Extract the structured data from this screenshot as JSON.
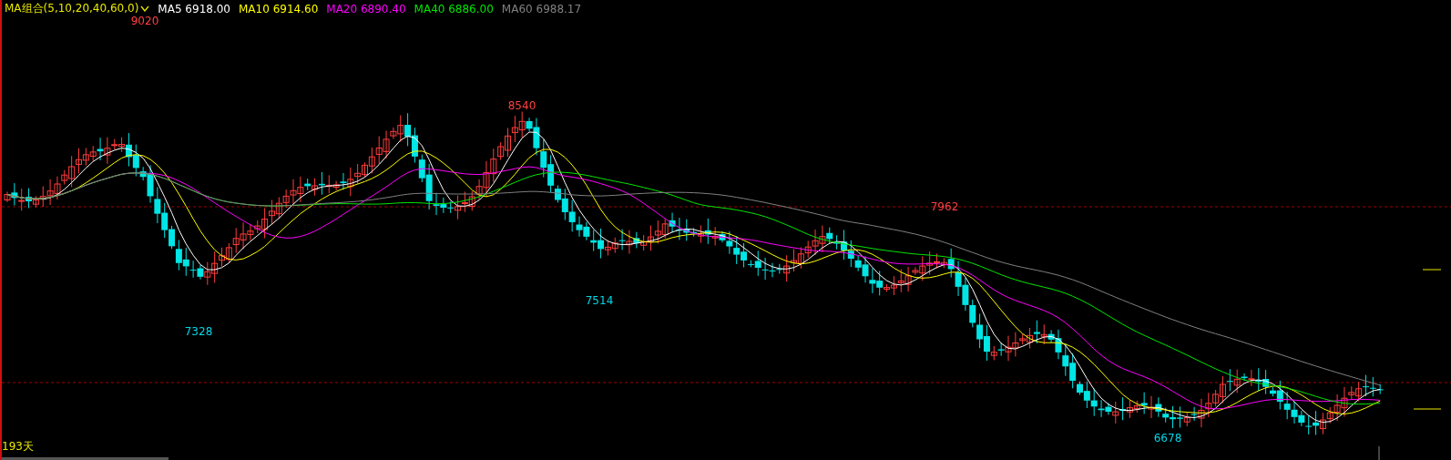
{
  "legend": {
    "indicator": "MA组合(5,10,20,40,60,0)",
    "items": [
      {
        "label": "MA5 6918.00",
        "color": "#ffffff"
      },
      {
        "label": "MA10 6914.60",
        "color": "#ffff00"
      },
      {
        "label": "MA20 6890.40",
        "color": "#ff00ff"
      },
      {
        "label": "MA40 6886.00",
        "color": "#00e600"
      },
      {
        "label": "MA60 6988.17",
        "color": "#808080"
      }
    ]
  },
  "price_labels": [
    {
      "text": "9020",
      "kind": "high"
    },
    {
      "text": "8540",
      "kind": "high"
    },
    {
      "text": "7962",
      "kind": "high"
    },
    {
      "text": "7328",
      "kind": "low"
    },
    {
      "text": "7514",
      "kind": "low"
    },
    {
      "text": "6678",
      "kind": "low"
    }
  ],
  "day_count": "193天"
}
